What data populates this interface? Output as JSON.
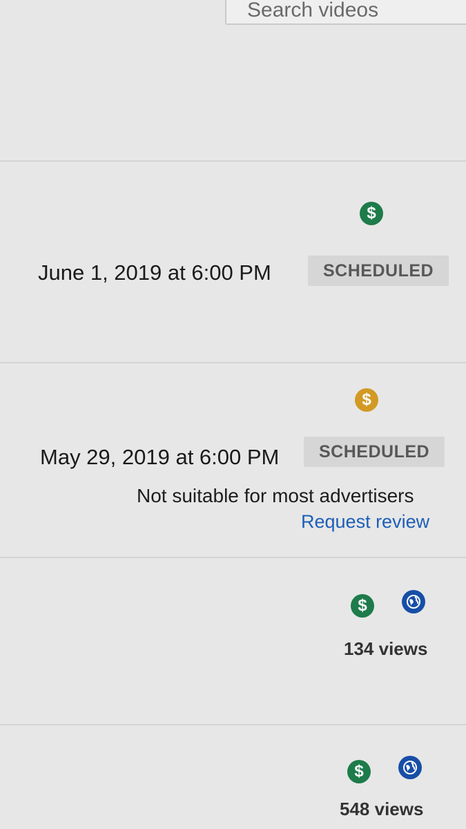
{
  "search": {
    "placeholder": "Search videos"
  },
  "videos": [
    {
      "monetization_icon": "dollar-icon",
      "monetization_color": "#1e7b4a",
      "date": "June 1, 2019 at 6:00 PM",
      "status": "SCHEDULED"
    },
    {
      "monetization_icon": "dollar-icon",
      "monetization_color": "#d29a24",
      "date": "May 29, 2019 at 6:00 PM",
      "status": "SCHEDULED",
      "restriction": "Not suitable for most advertisers",
      "action": "Request review"
    },
    {
      "monetization_icon": "dollar-icon",
      "monetization_color": "#1e7b4a",
      "visibility_icon": "globe-icon",
      "visibility_color": "#174ea6",
      "views": "134 views"
    },
    {
      "monetization_icon": "dollar-icon",
      "monetization_color": "#1e7b4a",
      "visibility_icon": "globe-icon",
      "visibility_color": "#174ea6",
      "views": "548 views"
    }
  ]
}
